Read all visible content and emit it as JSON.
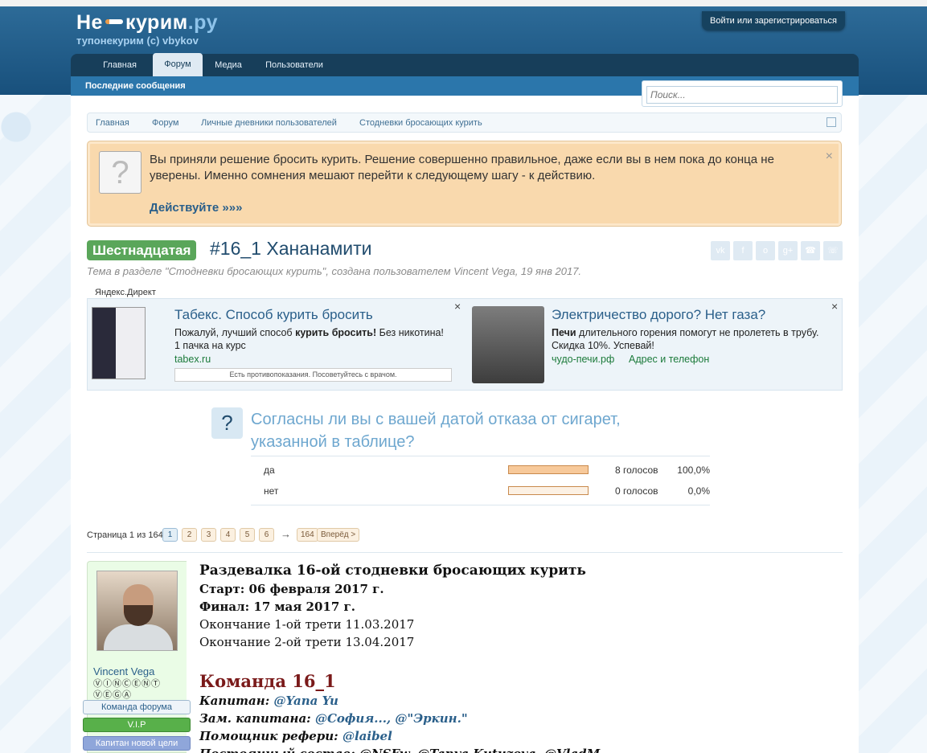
{
  "header": {
    "logo_main": "Не",
    "logo_domain": "курим",
    "logo_tld": ".ру",
    "slogan": "тупонекурим (с) vbykov",
    "login_button": "Войти или зарегистрироваться"
  },
  "nav": {
    "tabs": [
      {
        "label": "Главная",
        "active": false
      },
      {
        "label": "Форум",
        "active": true
      },
      {
        "label": "Медиа",
        "active": false
      },
      {
        "label": "Пользователи",
        "active": false
      }
    ],
    "subnav_link": "Последние сообщения"
  },
  "search": {
    "placeholder": "Поиск..."
  },
  "breadcrumbs": [
    "Главная",
    "Форум",
    "Личные дневники пользователей",
    "Стодневки бросающих курить"
  ],
  "notice": {
    "text": "Вы приняли решение бросить курить. Решение совершенно правильное, даже если вы в нем пока до конца не уверены. Именно сомнения мешают перейти к следующему шагу - к действию.",
    "action": "Действуйте »»»",
    "close": "×"
  },
  "thread": {
    "prefix": "Шестнадцатая",
    "title": "#16_1 Хананамити",
    "meta": "Тема в разделе \"Стодневки бросающих курить\", создана пользователем Vincent Vega, 19 янв 2017."
  },
  "share_icons": [
    "vk-icon",
    "facebook-icon",
    "odnoklassniki-icon",
    "googleplus-icon",
    "viber-icon",
    "whatsapp-icon"
  ],
  "ads": {
    "label": "Яндекс.Директ",
    "items": [
      {
        "title": "Табекс. Способ курить бросить",
        "text_pre": "Пожалуй, лучший способ ",
        "text_bold": "курить бросить!",
        "text_post": " Без никотина!",
        "text_line2": "1 пачка на курс",
        "link": "tabex.ru",
        "note": "Есть противопоказания. Посоветуйтесь с врачом.",
        "close": "×"
      },
      {
        "title": "Электричество дорого? Нет газа?",
        "text_bold": "Печи",
        "text_post": " длительного горения помогут не пролететь в трубу.",
        "text_line2": "Скидка 10%. Успевай!",
        "link": "чудо-печи.рф",
        "link2": "Адрес и телефон",
        "close": "×"
      }
    ]
  },
  "poll": {
    "icon": "?",
    "question": "Согласны ли вы с вашей датой отказа от сигарет, указанной в таблице?",
    "options": [
      {
        "label": "да",
        "votes": "8 голосов",
        "percent": "100,0%",
        "fraction": 1.0
      },
      {
        "label": "нет",
        "votes": "0 голосов",
        "percent": "0,0%",
        "fraction": 0.0
      }
    ]
  },
  "pagination": {
    "info": "Страница 1 из 164",
    "pages": [
      "1",
      "2",
      "3",
      "4",
      "5",
      "6"
    ],
    "current": "1",
    "arrow": "→",
    "last": "164",
    "next": "Вперёд >"
  },
  "user": {
    "name": "Vincent Vega",
    "title": "ⓋⒾⓃⒸⒺⓃⓉ ⓋⒺⒼⒶ",
    "badges": [
      {
        "label": "Команда форума",
        "bg": "#eef4f9",
        "border": "#9fb9cf",
        "color": "#2a5f8a"
      },
      {
        "label": "V.I.P",
        "bg": "#58b04a",
        "border": "#3d8a33",
        "color": "#ffffff"
      },
      {
        "label": "Капитан новой цели",
        "bg": "#8fa6da",
        "border": "#6f86c0",
        "color": "#ffffff"
      }
    ]
  },
  "post": {
    "heading": "Раздевалка 16-ой стодневки бросающих курить",
    "start": "Старт: 06 февраля 2017 г.",
    "finish": "Финал: 17 мая 2017 г.",
    "third1": "Окончание 1-ой трети 11.03.2017",
    "third2": "Окончание 2-ой трети 13.04.2017",
    "team": "Команда 16_1",
    "captain_label": "Капитан:",
    "captain_value": "@Yana Yu",
    "vice_label": "Зам. капитана:",
    "vice_value": "@София..., @\"Эркин.\"",
    "ref_label": "Помощник рефери:",
    "ref_value": "@laibel",
    "cut_line": "Постоянный состав: @NSFw, @Tanya Kutuzova, @VladM"
  },
  "colors": {
    "header_bg": "#1d5a87",
    "nav_bg": "#173e5a",
    "accent_link": "#2a5f8a",
    "notice_bg": "#f9d9ad",
    "prefix_green": "#5aa65a",
    "team_heading": "#7a1a1a"
  }
}
